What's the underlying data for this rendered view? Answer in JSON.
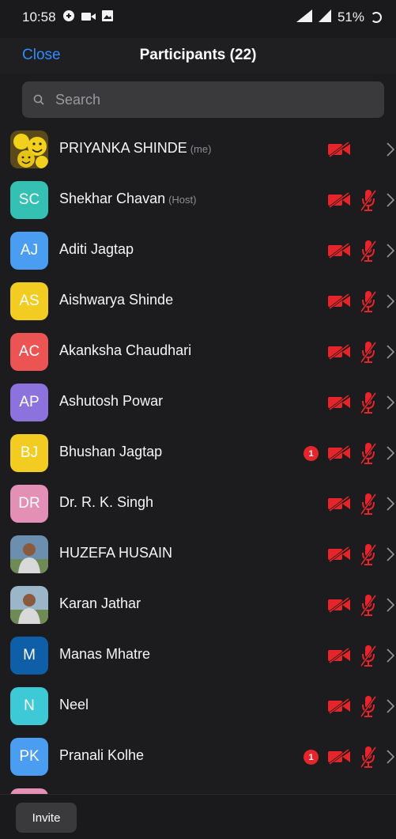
{
  "status_bar": {
    "time": "10:58",
    "battery": "51%"
  },
  "header": {
    "close_label": "Close",
    "title": "Participants (22)"
  },
  "search": {
    "placeholder": "Search"
  },
  "colors": {
    "accent": "#2d8cff",
    "muted_red": "#e5252a",
    "background": "#1c1c1e"
  },
  "participants": [
    {
      "name": "PRIYANKA SHINDE",
      "tag": "(me)",
      "initials": "",
      "avatar": "emoji-photo",
      "avatar_color": "#c9b21a",
      "video_off": true,
      "mic_muted": false,
      "unread": ""
    },
    {
      "name": "Shekhar Chavan",
      "tag": "(Host)",
      "initials": "SC",
      "avatar_color": "#34c1b4",
      "video_off": true,
      "mic_muted": true,
      "unread": ""
    },
    {
      "name": "Aditi Jagtap",
      "tag": "",
      "initials": "AJ",
      "avatar_color": "#4a9df0",
      "video_off": true,
      "mic_muted": true,
      "unread": ""
    },
    {
      "name": "Aishwarya Shinde",
      "tag": "",
      "initials": "AS",
      "avatar_color": "#f3cc22",
      "video_off": true,
      "mic_muted": true,
      "unread": ""
    },
    {
      "name": "Akanksha Chaudhari",
      "tag": "",
      "initials": "AC",
      "avatar_color": "#ec5454",
      "video_off": true,
      "mic_muted": true,
      "unread": ""
    },
    {
      "name": "Ashutosh Powar",
      "tag": "",
      "initials": "AP",
      "avatar_color": "#8b72dc",
      "video_off": true,
      "mic_muted": true,
      "unread": ""
    },
    {
      "name": "Bhushan Jagtap",
      "tag": "",
      "initials": "BJ",
      "avatar_color": "#f3cc22",
      "video_off": true,
      "mic_muted": true,
      "unread": "1"
    },
    {
      "name": "Dr. R. K. Singh",
      "tag": "",
      "initials": "DR",
      "avatar_color": "#e38fb6",
      "video_off": true,
      "mic_muted": true,
      "unread": ""
    },
    {
      "name": "HUZEFA HUSAIN",
      "tag": "",
      "initials": "",
      "avatar": "person-photo",
      "avatar_color": "#6c8fb0",
      "video_off": true,
      "mic_muted": true,
      "unread": ""
    },
    {
      "name": "Karan Jathar",
      "tag": "",
      "initials": "",
      "avatar": "person-photo",
      "avatar_color": "#9bb6c9",
      "video_off": true,
      "mic_muted": true,
      "unread": ""
    },
    {
      "name": "Manas Mhatre",
      "tag": "",
      "initials": "M",
      "avatar_color": "#0e5ea8",
      "video_off": true,
      "mic_muted": true,
      "unread": ""
    },
    {
      "name": "Neel",
      "tag": "",
      "initials": "N",
      "avatar_color": "#3dc9d6",
      "video_off": true,
      "mic_muted": true,
      "unread": ""
    },
    {
      "name": "Pranali Kolhe",
      "tag": "",
      "initials": "PK",
      "avatar_color": "#4a9df0",
      "video_off": true,
      "mic_muted": true,
      "unread": "1"
    }
  ],
  "footer": {
    "invite_label": "Invite"
  }
}
